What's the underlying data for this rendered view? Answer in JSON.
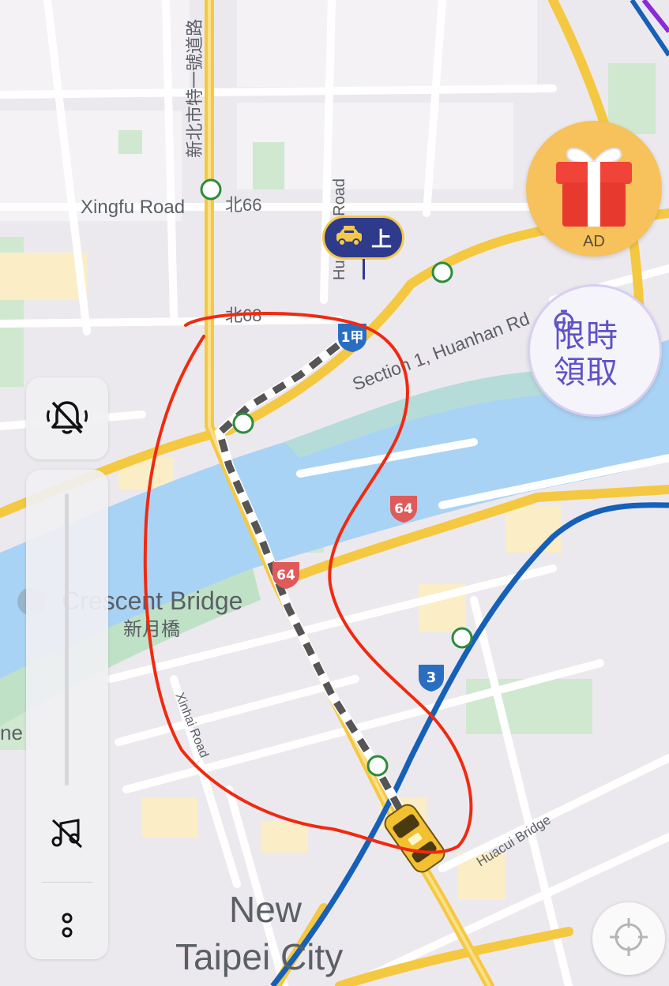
{
  "map": {
    "road_labels": {
      "xingfu_road": "Xingfu Road",
      "section1_huanhan": "Section 1, Huanhan Rd",
      "xinhai_road": "Xinhai Road",
      "huacui_bridge": "Huacui Bridge",
      "vertical_road": "Hu...ang Road",
      "special_road": "新北市特一號道路",
      "bus_66": "北66",
      "bus_68": "北68"
    },
    "places": {
      "crescent_bridge_en": "Crescent Bridge",
      "crescent_bridge_zh": "新月橋",
      "city_line1": "New",
      "city_line2": "Taipei City",
      "edge_partial": "ne"
    },
    "shields": {
      "route_1jia": "1甲",
      "route_64_a": "64",
      "route_64_b": "64",
      "route_3": "3"
    },
    "colors": {
      "route_dash": "#555555",
      "highway": "#f5c842",
      "metro_blue": "#1660b8",
      "river": "#a9d3f5",
      "annotation_red": "#f02a10"
    }
  },
  "pickup_marker": {
    "label": "上",
    "icon": "taxi-icon"
  },
  "controls": {
    "bell_icon": "bell-off-icon",
    "music_icon": "music-off-icon",
    "more_icon": "more-vertical-icon",
    "locate_icon": "crosshair-icon"
  },
  "promo": {
    "gift_label": "AD",
    "gift_icon": "gift-icon",
    "limited_label": "限時領取"
  }
}
